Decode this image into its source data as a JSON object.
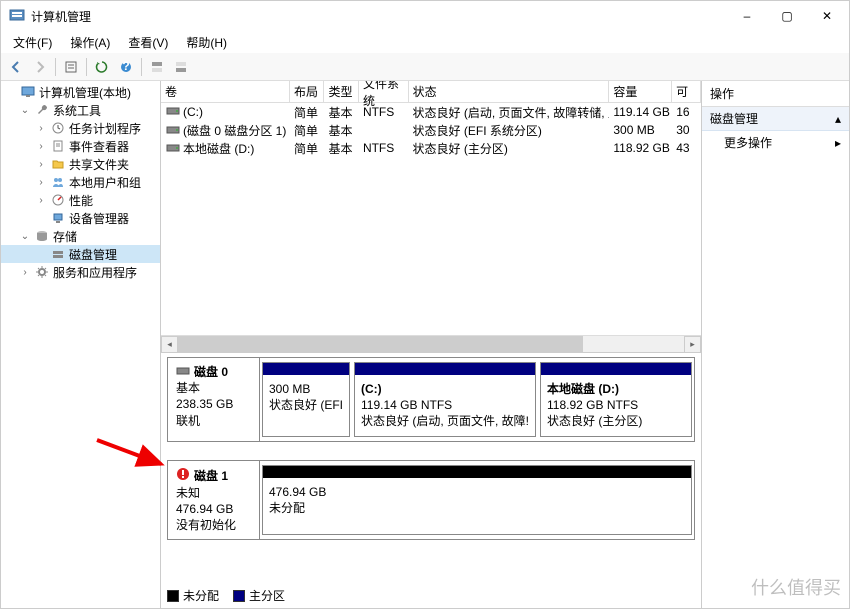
{
  "window": {
    "title": "计算机管理",
    "controls": {
      "min": "–",
      "max": "▢",
      "close": "✕"
    }
  },
  "menu": {
    "file": "文件(F)",
    "action": "操作(A)",
    "view": "查看(V)",
    "help": "帮助(H)"
  },
  "tree": {
    "root": "计算机管理(本地)",
    "system_tools": "系统工具",
    "task_scheduler": "任务计划程序",
    "event_viewer": "事件查看器",
    "shared_folders": "共享文件夹",
    "local_users": "本地用户和组",
    "performance": "性能",
    "device_manager": "设备管理器",
    "storage": "存储",
    "disk_management": "磁盘管理",
    "services": "服务和应用程序"
  },
  "columns": {
    "volume": "卷",
    "layout": "布局",
    "type": "类型",
    "filesystem": "文件系统",
    "status": "状态",
    "capacity": "容量",
    "free": "可"
  },
  "volumes": [
    {
      "name": "(C:)",
      "layout": "简单",
      "type": "基本",
      "fs": "NTFS",
      "status": "状态良好 (启动, 页面文件, 故障转储, 主分区)",
      "capacity": "119.14 GB",
      "free": "16"
    },
    {
      "name": "(磁盘 0 磁盘分区 1)",
      "layout": "简单",
      "type": "基本",
      "fs": "",
      "status": "状态良好 (EFI 系统分区)",
      "capacity": "300 MB",
      "free": "30"
    },
    {
      "name": "本地磁盘 (D:)",
      "layout": "简单",
      "type": "基本",
      "fs": "NTFS",
      "status": "状态良好 (主分区)",
      "capacity": "118.92 GB",
      "free": "43"
    }
  ],
  "disks": [
    {
      "title": "磁盘 0",
      "kind": "基本",
      "size": "238.35 GB",
      "state": "联机",
      "parts": [
        {
          "title": "",
          "line1": "300 MB",
          "line2": "状态良好 (EFI",
          "flex": 1,
          "bar": "primary"
        },
        {
          "title": "(C:)",
          "line1": "119.14 GB NTFS",
          "line2": "状态良好 (启动, 页面文件, 故障!",
          "flex": 2.4,
          "bar": "primary"
        },
        {
          "title": "本地磁盘  (D:)",
          "line1": "118.92 GB NTFS",
          "line2": "状态良好 (主分区)",
          "flex": 2.2,
          "bar": "primary"
        }
      ]
    },
    {
      "title": "磁盘 1",
      "kind": "未知",
      "size": "476.94 GB",
      "state": "没有初始化",
      "icon_badge": "warn",
      "parts": [
        {
          "title": "",
          "line1": "476.94 GB",
          "line2": "未分配",
          "flex": 1,
          "bar": "unalloc"
        }
      ]
    }
  ],
  "legend": {
    "unallocated": "未分配",
    "primary": "主分区"
  },
  "actions": {
    "header": "操作",
    "category": "磁盘管理",
    "more": "更多操作"
  },
  "watermark": "什么值得买"
}
